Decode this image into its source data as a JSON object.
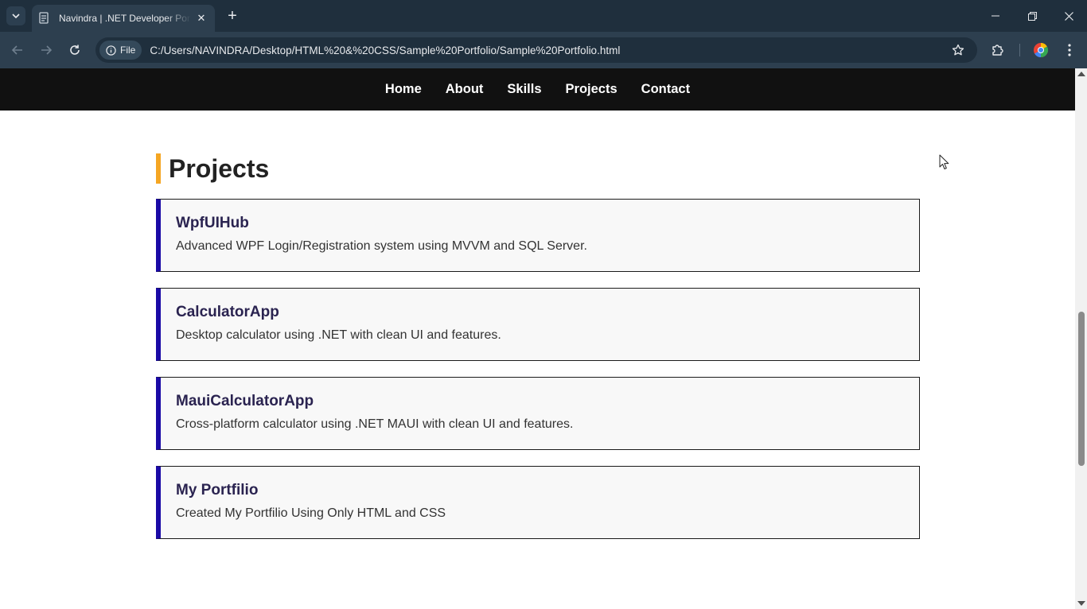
{
  "browser": {
    "tab_title": "Navindra | .NET Developer Portfolio",
    "new_tab_label": "+",
    "site_info_label": "File",
    "url": "C:/Users/NAVINDRA/Desktop/HTML%20&%20CSS/Sample%20Portfolio/Sample%20Portfolio.html"
  },
  "nav": {
    "items": [
      "Home",
      "About",
      "Skills",
      "Projects",
      "Contact"
    ]
  },
  "projects_section": {
    "title": "Projects",
    "items": [
      {
        "name": "WpfUIHub",
        "description": "Advanced WPF Login/Registration system using MVVM and SQL Server."
      },
      {
        "name": "CalculatorApp",
        "description": "Desktop calculator using .NET with clean UI and features."
      },
      {
        "name": "MauiCalculatorApp",
        "description": "Cross-platform calculator using .NET MAUI with clean UI and features."
      },
      {
        "name": "My Portfilio",
        "description": "Created My Portfilio Using Only HTML and CSS"
      }
    ]
  },
  "colors": {
    "nav_bg": "#111111",
    "title_accent": "#f5a623",
    "card_accent": "#1a0aa6",
    "project_name": "#2a2350"
  }
}
